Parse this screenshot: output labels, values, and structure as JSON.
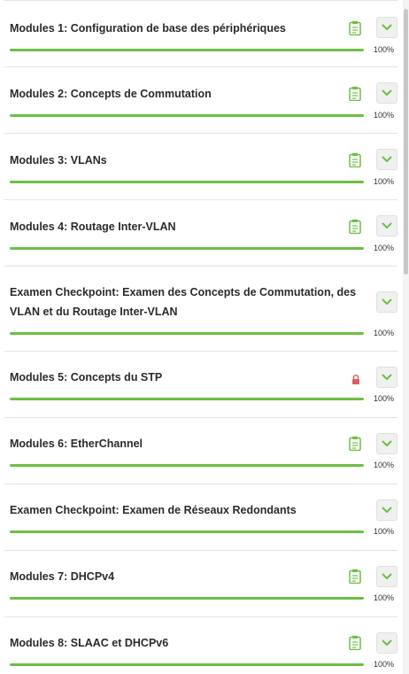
{
  "colors": {
    "accent": "#6cbf44",
    "lock": "#e05a5a"
  },
  "modules": [
    {
      "title": "Modules 1: Configuration de base des périphériques",
      "icon": "clipboard-icon",
      "progress": 100,
      "percent_label": "100%"
    },
    {
      "title": "Modules 2: Concepts de Commutation",
      "icon": "clipboard-icon",
      "progress": 100,
      "percent_label": "100%"
    },
    {
      "title": "Modules 3: VLANs",
      "icon": "clipboard-icon",
      "progress": 100,
      "percent_label": "100%"
    },
    {
      "title": "Modules 4: Routage Inter-VLAN",
      "icon": "clipboard-icon",
      "progress": 100,
      "percent_label": "100%"
    },
    {
      "title_line1": "Examen Checkpoint: Examen des Concepts de Commutation, des",
      "title_line2": "VLAN et du Routage Inter-VLAN",
      "icon": "none",
      "progress": 100,
      "percent_label": "100%"
    },
    {
      "title": "Modules 5: Concepts du STP",
      "icon": "lock-icon",
      "progress": 100,
      "percent_label": "100%"
    },
    {
      "title": "Modules 6: EtherChannel",
      "icon": "clipboard-icon",
      "progress": 100,
      "percent_label": "100%"
    },
    {
      "title": "Examen Checkpoint: Examen de Réseaux Redondants",
      "icon": "none",
      "progress": 100,
      "percent_label": "100%"
    },
    {
      "title": "Modules 7: DHCPv4",
      "icon": "clipboard-icon",
      "progress": 100,
      "percent_label": "100%"
    },
    {
      "title": "Modules 8: SLAAC et DHCPv6",
      "icon": "clipboard-icon",
      "progress": 100,
      "percent_label": "100%"
    }
  ]
}
